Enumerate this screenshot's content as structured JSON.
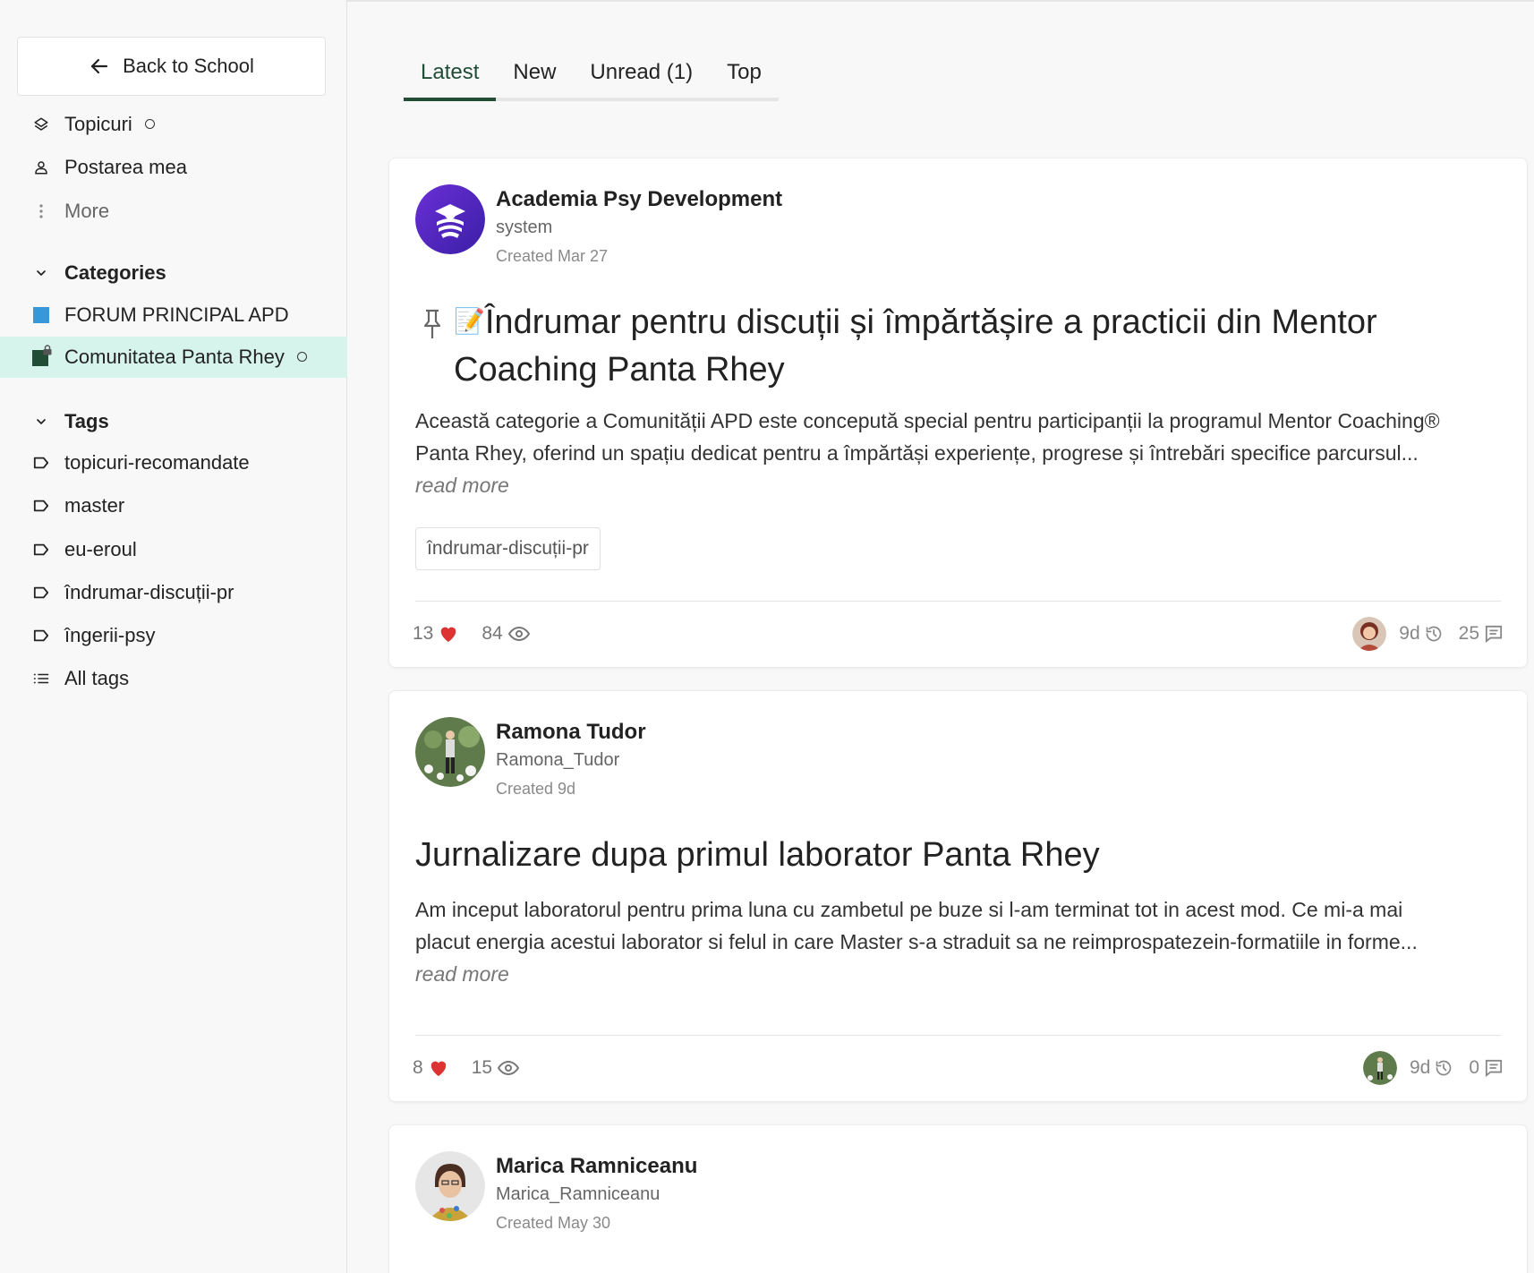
{
  "sidebar": {
    "back_label": "Back to School",
    "nav": [
      {
        "label": "Topicuri",
        "icon": "layers-icon"
      },
      {
        "label": "Postarea mea",
        "icon": "user-icon"
      },
      {
        "label": "More",
        "icon": "more-vertical-icon"
      }
    ],
    "categories_heading": "Categories",
    "categories": [
      {
        "label": "FORUM PRINCIPAL APD",
        "color": "#3498db"
      },
      {
        "label": "Comunitatea Panta Rhey",
        "color": "#214d36"
      }
    ],
    "tags_heading": "Tags",
    "tags": [
      "topicuri-recomandate",
      "master",
      "eu-eroul",
      "îndrumar-discuții-pr",
      "îngerii-psy"
    ],
    "all_tags_label": "All tags"
  },
  "tabs": [
    "Latest",
    "New",
    "Unread (1)",
    "Top"
  ],
  "accent_color": "#214d36",
  "posts": [
    {
      "author": "Academia Psy Development",
      "username": "system",
      "created": "Created Mar 27",
      "title_prefix": "📝",
      "title": "Îndrumar pentru discuții și împărtășire a practicii din Mentor Coaching Panta Rhey",
      "excerpt": "Această categorie a Comunității APD este concepută special pentru participanții la programul Mentor Coaching® Panta Rhey, oferind un spațiu dedicat pentru a împărtăși experiențe, progrese și întrebări specifice parcursul...",
      "read_more": "read more",
      "tag": "îndrumar-discuții-pr",
      "likes": "13",
      "views": "84",
      "activity": "9d",
      "replies": "25"
    },
    {
      "author": "Ramona Tudor",
      "username": "Ramona_Tudor",
      "created": "Created 9d",
      "title": "Jurnalizare dupa primul laborator Panta Rhey",
      "excerpt": "Am inceput laboratorul pentru prima luna cu zambetul pe buze si l-am terminat tot in acest mod. Ce mi-a mai placut energia acestui laborator si felul in care Master s-a straduit sa ne reimprospatezein-formatiile in forme...",
      "read_more": "read more",
      "likes": "8",
      "views": "15",
      "activity": "9d",
      "replies": "0"
    },
    {
      "author": "Marica Ramniceanu",
      "username": "Marica_Ramniceanu",
      "created": "Created May 30"
    }
  ]
}
